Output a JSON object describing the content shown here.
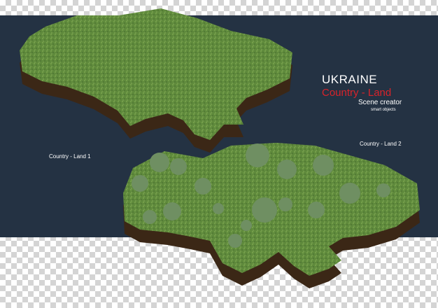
{
  "title": "UKRAINE",
  "subtitle": "Country - Land",
  "creator": "Scene creator",
  "smart_objects": "smart objects",
  "labels": {
    "land1": "Country - Land 1",
    "land2": "Country - Land 2"
  },
  "colors": {
    "panel": "#243243",
    "accent": "#d8232a",
    "grass": "#5f8a3c",
    "soil": "#3b2716",
    "tree": "#6f8f62"
  }
}
